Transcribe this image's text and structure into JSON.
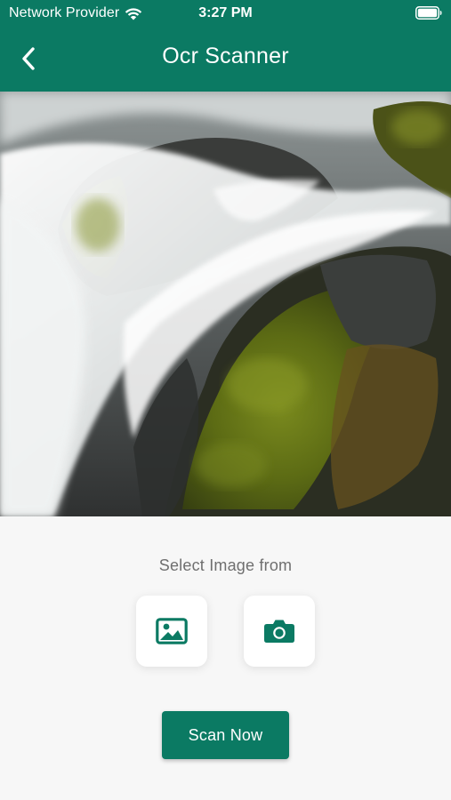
{
  "status_bar": {
    "carrier": "Network Provider",
    "time": "3:27 PM",
    "wifi_icon": "wifi-icon",
    "battery_icon": "battery-icon"
  },
  "nav": {
    "title": "Ocr Scanner",
    "back_icon": "chevron-left-icon"
  },
  "selected_image": {
    "subject": "waterfall-photo"
  },
  "source_picker": {
    "label": "Select Image from",
    "options": [
      {
        "icon": "image-gallery-icon"
      },
      {
        "icon": "camera-icon"
      }
    ]
  },
  "actions": {
    "scan_label": "Scan Now"
  },
  "colors": {
    "accent": "#0b7a63",
    "background": "#f7f7f7",
    "label_text": "#6f6f6f"
  }
}
